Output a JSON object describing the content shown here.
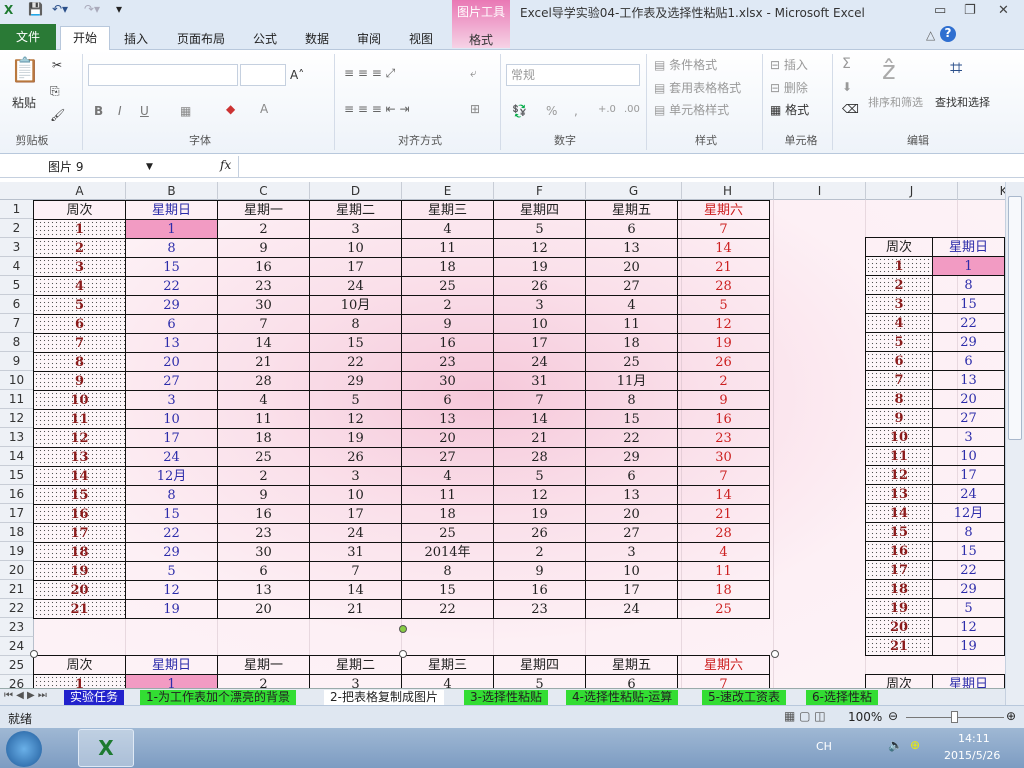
{
  "title_bar": {
    "title": "Excel导学实验04-工作表及选择性粘贴1.xlsx - Microsoft Excel",
    "context_tab": "图片工具",
    "context_sub": "格式",
    "minimize": "▭",
    "restore": "❐",
    "close": "✕"
  },
  "tabs": [
    "文件",
    "开始",
    "插入",
    "页面布局",
    "公式",
    "数据",
    "审阅",
    "视图"
  ],
  "ribbon": {
    "clipboard": {
      "paste": "粘贴",
      "group": "剪贴板"
    },
    "font": {
      "group": "字体",
      "bold": "B",
      "italic": "I",
      "underline": "U",
      "grow": "A˄",
      "shrink": "A˅"
    },
    "alignment": {
      "group": "对齐方式"
    },
    "number": {
      "group": "数字",
      "format": "常规",
      "percent": "%",
      "comma": ",",
      "inc": "+.0",
      "dec": ".00"
    },
    "styles": {
      "group": "样式",
      "conditional": "条件格式",
      "table": "套用表格格式",
      "cell": "单元格样式"
    },
    "cells": {
      "group": "单元格",
      "insert": "插入",
      "delete": "删除",
      "format": "格式"
    },
    "editing": {
      "group": "编辑",
      "sum": "Σ",
      "sort": "排序和筛选",
      "find": "查找和选择"
    }
  },
  "formula_bar": {
    "name_box": "图片 9",
    "fx": "fx",
    "formula": ""
  },
  "columns": [
    "A",
    "B",
    "C",
    "D",
    "E",
    "F",
    "G",
    "H",
    "I",
    "J",
    "K"
  ],
  "headers": [
    "周次",
    "星期日",
    "星期一",
    "星期二",
    "星期三",
    "星期四",
    "星期五",
    "星期六"
  ],
  "calendar": [
    [
      "1",
      "1",
      "2",
      "3",
      "4",
      "5",
      "6",
      "7"
    ],
    [
      "2",
      "8",
      "9",
      "10",
      "11",
      "12",
      "13",
      "14"
    ],
    [
      "3",
      "15",
      "16",
      "17",
      "18",
      "19",
      "20",
      "21"
    ],
    [
      "4",
      "22",
      "23",
      "24",
      "25",
      "26",
      "27",
      "28"
    ],
    [
      "5",
      "29",
      "30",
      "10月",
      "2",
      "3",
      "4",
      "5"
    ],
    [
      "6",
      "6",
      "7",
      "8",
      "9",
      "10",
      "11",
      "12"
    ],
    [
      "7",
      "13",
      "14",
      "15",
      "16",
      "17",
      "18",
      "19"
    ],
    [
      "8",
      "20",
      "21",
      "22",
      "23",
      "24",
      "25",
      "26"
    ],
    [
      "9",
      "27",
      "28",
      "29",
      "30",
      "31",
      "11月",
      "2"
    ],
    [
      "10",
      "3",
      "4",
      "5",
      "6",
      "7",
      "8",
      "9"
    ],
    [
      "11",
      "10",
      "11",
      "12",
      "13",
      "14",
      "15",
      "16"
    ],
    [
      "12",
      "17",
      "18",
      "19",
      "20",
      "21",
      "22",
      "23"
    ],
    [
      "13",
      "24",
      "25",
      "26",
      "27",
      "28",
      "29",
      "30"
    ],
    [
      "14",
      "12月",
      "2",
      "3",
      "4",
      "5",
      "6",
      "7"
    ],
    [
      "15",
      "8",
      "9",
      "10",
      "11",
      "12",
      "13",
      "14"
    ],
    [
      "16",
      "15",
      "16",
      "17",
      "18",
      "19",
      "20",
      "21"
    ],
    [
      "17",
      "22",
      "23",
      "24",
      "25",
      "26",
      "27",
      "28"
    ],
    [
      "18",
      "29",
      "30",
      "31",
      "2014年",
      "2",
      "3",
      "4"
    ],
    [
      "19",
      "5",
      "6",
      "7",
      "8",
      "9",
      "10",
      "11"
    ],
    [
      "20",
      "12",
      "13",
      "14",
      "15",
      "16",
      "17",
      "18"
    ],
    [
      "21",
      "19",
      "20",
      "21",
      "22",
      "23",
      "24",
      "25"
    ]
  ],
  "sheet_tabs": [
    "实验任务",
    "1-为工作表加个漂亮的背景",
    "2-把表格复制成图片",
    "3-选择性粘贴",
    "4-选择性粘贴-运算",
    "5-速改工资表",
    "6-选择性粘"
  ],
  "active_sheet": 2,
  "status": {
    "ready": "就绪",
    "zoom": "100%"
  },
  "taskbar": {
    "lang": "CH",
    "time": "14:11",
    "date": "2015/5/26"
  },
  "colors": {
    "accent": "#2a7a36",
    "sunday": "#2d2daa",
    "saturday": "#cc2020",
    "week": "#8b1a1a",
    "highlight": "#f29bc3"
  }
}
